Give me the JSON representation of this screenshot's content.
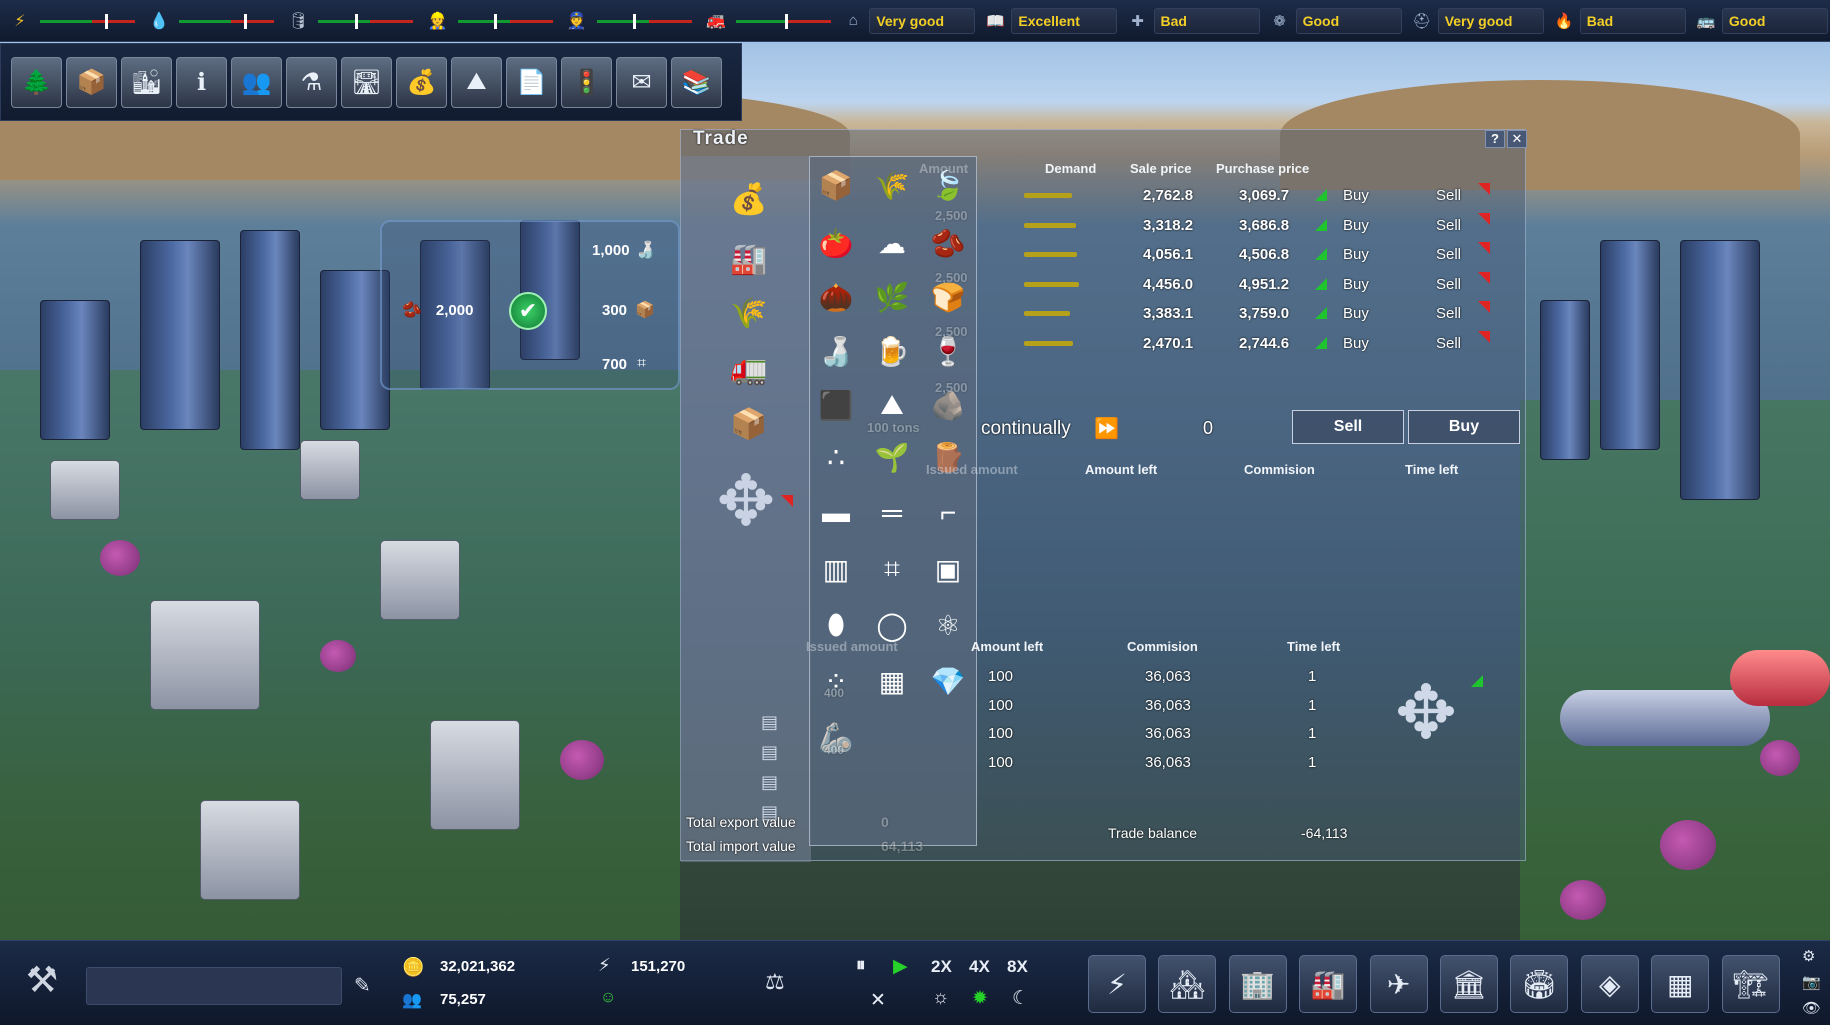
{
  "top_bar": {
    "sliders": [
      {
        "icon": "energy-icon",
        "glyph": "⚡",
        "color": "#f2c22a",
        "knob_pct": 68
      },
      {
        "icon": "water-icon",
        "glyph": "💧",
        "color": "#4ba6ff",
        "knob_pct": 68
      },
      {
        "icon": "waste-icon",
        "glyph": "🛢",
        "color": "#b8c2d2",
        "knob_pct": 38
      },
      {
        "icon": "worker-icon",
        "glyph": "👷",
        "color": "#f2c22a",
        "knob_pct": 38
      },
      {
        "icon": "police-icon",
        "glyph": "👮",
        "color": "#cfd8e8",
        "knob_pct": 38
      },
      {
        "icon": "firefighter-icon",
        "glyph": "🚒",
        "color": "#cfd8e8",
        "knob_pct": 52
      }
    ],
    "ratings": [
      {
        "icon": "housing-icon",
        "glyph": "⌂",
        "value": "Very good"
      },
      {
        "icon": "education-icon",
        "glyph": "📖",
        "value": "Excellent"
      },
      {
        "icon": "health-icon",
        "glyph": "✚",
        "value": "Bad"
      },
      {
        "icon": "environment-icon",
        "glyph": "❁",
        "value": "Good"
      },
      {
        "icon": "safety-icon",
        "glyph": "⛑",
        "value": "Very good"
      },
      {
        "icon": "fire-safety-icon",
        "glyph": "🔥",
        "value": "Bad"
      },
      {
        "icon": "transport-icon",
        "glyph": "🚌",
        "value": "Good"
      }
    ]
  },
  "category_toolbar": [
    {
      "icon": "nature-icon",
      "glyph": "🌲"
    },
    {
      "icon": "goods-crate-icon",
      "glyph": "📦"
    },
    {
      "icon": "city-overview-icon",
      "glyph": "🏙"
    },
    {
      "icon": "info-icon",
      "glyph": "ℹ"
    },
    {
      "icon": "population-icon",
      "glyph": "👥"
    },
    {
      "icon": "research-flask-icon",
      "glyph": "⚗"
    },
    {
      "icon": "roads-icon",
      "glyph": "🛣"
    },
    {
      "icon": "finance-icon",
      "glyph": "💰"
    },
    {
      "icon": "terrain-icon",
      "glyph": "⛰"
    },
    {
      "icon": "documents-icon",
      "glyph": "📄"
    },
    {
      "icon": "traffic-icon",
      "glyph": "🚦"
    },
    {
      "icon": "mail-icon",
      "glyph": "✉"
    },
    {
      "icon": "library-icon",
      "glyph": "📚"
    }
  ],
  "overlay_tags": [
    {
      "value": "1,000",
      "icon": "bottles-icon"
    },
    {
      "value": "2,000",
      "icon": "cocoa-icon"
    },
    {
      "value": "300",
      "icon": "crate-icon"
    },
    {
      "value": "700",
      "icon": "structure-icon"
    }
  ],
  "trade": {
    "title": "Trade",
    "help_label": "?",
    "close_label": "✕",
    "headers": {
      "amount": "Amount",
      "demand": "Demand",
      "sale_price": "Sale price",
      "purchase_price": "Purchase price"
    },
    "rows": [
      {
        "sale": "2,762.8",
        "purchase": "3,069.7",
        "buy": "Buy",
        "sell": "Sell"
      },
      {
        "sale": "3,318.2",
        "purchase": "3,686.8",
        "buy": "Buy",
        "sell": "Sell"
      },
      {
        "sale": "4,056.1",
        "purchase": "4,506.8",
        "buy": "Buy",
        "sell": "Sell"
      },
      {
        "sale": "4,456.0",
        "purchase": "4,951.2",
        "buy": "Buy",
        "sell": "Sell"
      },
      {
        "sale": "3,383.1",
        "purchase": "3,759.0",
        "buy": "Buy",
        "sell": "Sell"
      },
      {
        "sale": "2,470.1",
        "purchase": "2,744.6",
        "buy": "Buy",
        "sell": "Sell"
      }
    ],
    "demand_levels": [
      0.85,
      0.92,
      0.95,
      0.98,
      0.82,
      0.88
    ],
    "order": {
      "mode": "continually",
      "quantity": "0",
      "sell_label": "Sell",
      "buy_label": "Buy"
    },
    "upper_headers": {
      "issued_amount": "Issued amount",
      "amount_left": "Amount left",
      "commission": "Commision",
      "time_left": "Time left"
    },
    "lower_headers": {
      "issued_amount": "Issued amount",
      "amount_left": "Amount left",
      "commission": "Commision",
      "time_left": "Time left"
    },
    "orders": [
      {
        "issued": "400",
        "left": "100",
        "commission": "36,063",
        "time": "1"
      },
      {
        "issued": "",
        "left": "100",
        "commission": "36,063",
        "time": "1"
      },
      {
        "issued": "400",
        "left": "100",
        "commission": "36,063",
        "time": "1"
      },
      {
        "issued": "",
        "left": "100",
        "commission": "36,063",
        "time": "1"
      }
    ],
    "ghost_amounts": [
      "2,500",
      "2,500",
      "2,500",
      "2,500",
      "100 tons"
    ],
    "totals": {
      "export_label": "Total export value",
      "export_value": "0",
      "import_label": "Total import value",
      "import_value": "64,113"
    },
    "balance": {
      "label": "Trade balance",
      "value": "-64,113"
    },
    "left_icons": [
      {
        "icon": "raw-materials-sack-icon",
        "glyph": "💰"
      },
      {
        "icon": "industry-goods-icon",
        "glyph": "🏭"
      },
      {
        "icon": "agriculture-icon",
        "glyph": "🌾"
      },
      {
        "icon": "transport-vehicle-icon",
        "glyph": "🚛"
      },
      {
        "icon": "crate-icon",
        "glyph": "📦"
      },
      {
        "icon": "trade-hub-icon",
        "glyph": "✥"
      }
    ],
    "goods_icons": [
      {
        "icon": "crate-icon",
        "glyph": "📦"
      },
      {
        "icon": "wheat-icon",
        "glyph": "🌾"
      },
      {
        "icon": "leaf-icon",
        "glyph": "🍃"
      },
      {
        "icon": "tomato-icon",
        "glyph": "🍅"
      },
      {
        "icon": "cotton-icon",
        "glyph": "☁"
      },
      {
        "icon": "cocoa-icon",
        "glyph": "🫘"
      },
      {
        "icon": "nut-icon",
        "glyph": "🌰"
      },
      {
        "icon": "herb-icon",
        "glyph": "🌿"
      },
      {
        "icon": "bread-icon",
        "glyph": "🍞"
      },
      {
        "icon": "bottles-icon",
        "glyph": "🍶"
      },
      {
        "icon": "beer-icon",
        "glyph": "🍺"
      },
      {
        "icon": "wine-icon",
        "glyph": "🍷"
      },
      {
        "icon": "coal-icon",
        "glyph": "⬛"
      },
      {
        "icon": "sand-icon",
        "glyph": "⛰"
      },
      {
        "icon": "ore-icon",
        "glyph": "🪨"
      },
      {
        "icon": "gravel-icon",
        "glyph": "∴"
      },
      {
        "icon": "plant-icon",
        "glyph": "🌱"
      },
      {
        "icon": "logs-icon",
        "glyph": "🪵"
      },
      {
        "icon": "concrete-block-icon",
        "glyph": "▬"
      },
      {
        "icon": "planks-icon",
        "glyph": "═"
      },
      {
        "icon": "steel-beam-icon",
        "glyph": "⌐"
      },
      {
        "icon": "glass-icon",
        "glyph": "▥"
      },
      {
        "icon": "structure-icon",
        "glyph": "⌗"
      },
      {
        "icon": "panel-icon",
        "glyph": "▣"
      },
      {
        "icon": "capsule-icon",
        "glyph": "⬮"
      },
      {
        "icon": "ring-icon",
        "glyph": "◯"
      },
      {
        "icon": "molecule-icon",
        "glyph": "⚛"
      },
      {
        "icon": "nanoparticles-icon",
        "glyph": "⁘"
      },
      {
        "icon": "microchip-icon",
        "glyph": "▦"
      },
      {
        "icon": "diamond-icon",
        "glyph": "💎"
      },
      {
        "icon": "robot-arm-icon",
        "glyph": "🦾"
      }
    ],
    "order_icons": [
      {
        "icon": "order-crate-icon",
        "glyph": "▤"
      },
      {
        "icon": "order-crate-icon",
        "glyph": "▤"
      },
      {
        "icon": "order-crate-icon",
        "glyph": "▤"
      },
      {
        "icon": "order-crate-icon",
        "glyph": "▤"
      }
    ]
  },
  "bottom_bar": {
    "money": "32,021,362",
    "population": "75,257",
    "power": "151,270",
    "speeds": [
      "2X",
      "4X",
      "8X"
    ],
    "build_buttons": [
      {
        "icon": "power-plant-icon",
        "glyph": "⚡"
      },
      {
        "icon": "residential-icon",
        "glyph": "🏘"
      },
      {
        "icon": "commercial-icon",
        "glyph": "🏢"
      },
      {
        "icon": "industrial-icon",
        "glyph": "🏭"
      },
      {
        "icon": "airport-icon",
        "glyph": "✈"
      },
      {
        "icon": "services-icon",
        "glyph": "🏛"
      },
      {
        "icon": "public-building-icon",
        "glyph": "🏟"
      },
      {
        "icon": "dome-icon",
        "glyph": "◈"
      },
      {
        "icon": "blocks-icon",
        "glyph": "▦"
      },
      {
        "icon": "demolish-crane-icon",
        "glyph": "🏗"
      }
    ]
  }
}
